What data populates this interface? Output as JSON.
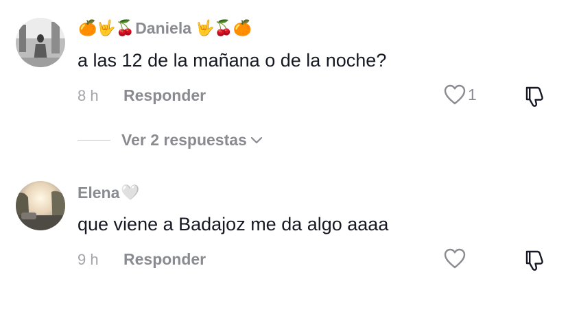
{
  "comments": [
    {
      "username_prefix_emoji": "🍊🤟🍒",
      "username": "Daniela",
      "username_suffix_emoji": "🤟🍒🍊",
      "text": "a las 12 de la mañana o de la noche?",
      "time": "8 h",
      "reply_label": "Responder",
      "like_count": "1",
      "view_replies_label": "Ver 2 respuestas",
      "avatar_icon": "avatar-photo-grayscale"
    },
    {
      "username": "Elena",
      "username_suffix_emoji": "🤍",
      "text": "que viene a Badajoz me da algo aaaa",
      "time": "9 h",
      "reply_label": "Responder",
      "like_count": "",
      "avatar_icon": "avatar-photo-sunset"
    }
  ],
  "icons": {
    "like": "heart-outline-icon",
    "dislike": "thumbs-down-icon",
    "expand": "chevron-down-icon"
  },
  "colors": {
    "text": "#161823",
    "secondary": "#8a8b91",
    "muted": "#a3a4a8",
    "divider": "#c8c9cc"
  }
}
